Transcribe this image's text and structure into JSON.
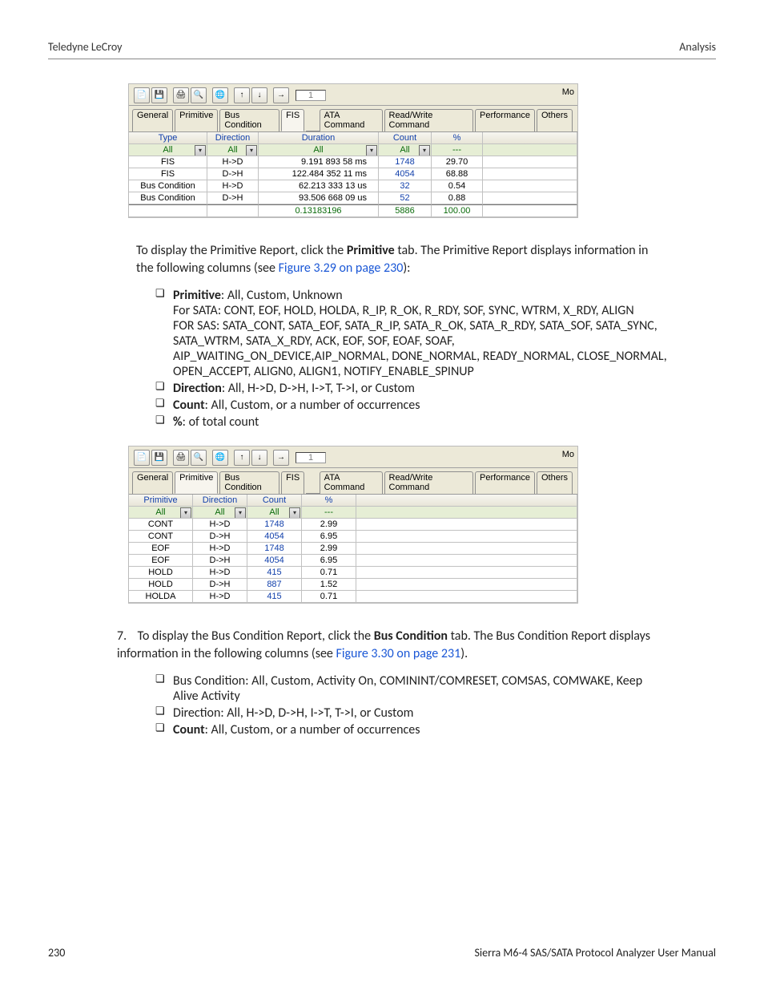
{
  "header": {
    "left": "Teledyne LeCroy",
    "right": "Analysis"
  },
  "shot1": {
    "mo": "Mo",
    "page_num": "1",
    "tabs": [
      "General",
      "Primitive",
      "Bus Condition",
      "FIS",
      "",
      "ATA Command",
      "Read/Write Command",
      "Performance",
      "Others"
    ],
    "selected_tab": 3,
    "cols": [
      "Type",
      "Direction",
      "Duration",
      "Count",
      "%"
    ],
    "filters": {
      "type": "All",
      "direction": "All",
      "duration": "All",
      "count": "All",
      "pct": "---"
    },
    "rows": [
      {
        "type": "FIS",
        "dir": "H->D",
        "dur": "9.191 893 58  ms",
        "cnt": "1748",
        "pct": "29.70"
      },
      {
        "type": "FIS",
        "dir": "D->H",
        "dur": "122.484 352 11  ms",
        "cnt": "4054",
        "pct": "68.88"
      },
      {
        "type": "Bus Condition",
        "dir": "H->D",
        "dur": "62.213 333 13  us",
        "cnt": "32",
        "pct": "0.54"
      },
      {
        "type": "Bus Condition",
        "dir": "D->H",
        "dur": "93.506 668 09  us",
        "cnt": "52",
        "pct": "0.88"
      }
    ],
    "total": {
      "dur": "0.13183196",
      "cnt": "5886",
      "pct": "100.00"
    }
  },
  "para1_a": "To display the Primitive Report, click the ",
  "para1_b": "Primitive",
  "para1_c": " tab. The Primitive Report displays information in the following columns (see ",
  "para1_link": "Figure 3.29 on page 230",
  "para1_d": "):",
  "b1": {
    "t1": "Primitive",
    "t1r": ": All, Custom, Unknown",
    "t1l2": "For SATA: CONT, EOF, HOLD, HOLDA, R_IP, R_OK, R_RDY, SOF, SYNC, WTRM, X_RDY, ALIGN",
    "t1l3": "FOR SAS: SATA_CONT, SATA_EOF, SATA_R_IP, SATA_R_OK, SATA_R_RDY, SATA_SOF, SATA_SYNC, SATA_WTRM, SATA_X_RDY, ACK, EOF, SOF, EOAF, SOAF, AIP_WAITING_ON_DEVICE,AIP_NORMAL, DONE_NORMAL, READY_NORMAL, CLOSE_NORMAL, OPEN_ACCEPT, ALIGN0, ALIGN1, NOTIFY_ENABLE_SPINUP",
    "t2": "Direction",
    "t2r": ": All, H->D, D->H, I->T, T->I, or Custom",
    "t3": "Count",
    "t3r": ": All, Custom, or a number of occurrences",
    "t4": "%",
    "t4r": ": of total count"
  },
  "shot2": {
    "mo": "Mo",
    "page_num": "1",
    "tabs": [
      "General",
      "Primitive",
      "Bus Condition",
      "FIS",
      "",
      "ATA Command",
      "Read/Write Command",
      "Performance",
      "Others"
    ],
    "selected_tab": 1,
    "cols": [
      "Primitive",
      "Direction",
      "Count",
      "%"
    ],
    "filters": {
      "prim": "All",
      "dir": "All",
      "cnt": "All",
      "pct": "---"
    },
    "rows": [
      {
        "p": "CONT",
        "d": "H->D",
        "c": "1748",
        "pct": "2.99"
      },
      {
        "p": "CONT",
        "d": "D->H",
        "c": "4054",
        "pct": "6.95"
      },
      {
        "p": "EOF",
        "d": "H->D",
        "c": "1748",
        "pct": "2.99"
      },
      {
        "p": "EOF",
        "d": "D->H",
        "c": "4054",
        "pct": "6.95"
      },
      {
        "p": "HOLD",
        "d": "H->D",
        "c": "415",
        "pct": "0.71"
      },
      {
        "p": "HOLD",
        "d": "D->H",
        "c": "887",
        "pct": "1.52"
      },
      {
        "p": "HOLDA",
        "d": "H->D",
        "c": "415",
        "pct": "0.71"
      }
    ]
  },
  "step7": {
    "num": "7.",
    "a": "To display the Bus Condition Report, click the ",
    "b": "Bus Condition",
    "c": " tab. The Bus Condition Report displays information in the following columns (see ",
    "link": "Figure 3.30 on page 231",
    "d": ")."
  },
  "b2": {
    "t1": "Bus Condition: All, Custom, Activity On, COMININT/COMRESET, COMSAS, COMWAKE, Keep Alive Activity",
    "t2": "Direction: All, H->D, D->H, I->T, T->I, or Custom",
    "t3b": "Count",
    "t3r": ": All, Custom, or a number of occurrences"
  },
  "footer": {
    "left": "230",
    "right": "Sierra M6-4 SAS/SATA Protocol Analyzer User Manual"
  }
}
